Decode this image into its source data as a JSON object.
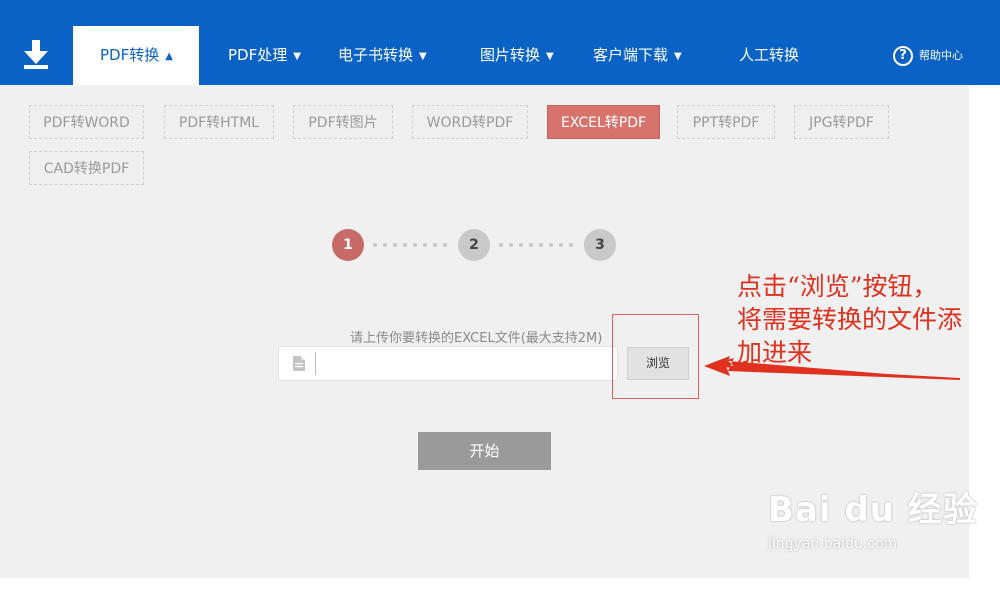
{
  "header": {
    "download_icon": "download-icon",
    "nav": [
      {
        "label": "PDF转换",
        "caret": "▲"
      },
      {
        "label": "PDF处理",
        "caret": "▼"
      },
      {
        "label": "电子书转换",
        "caret": "▼"
      },
      {
        "label": "图片转换",
        "caret": "▼"
      },
      {
        "label": "客户端下载",
        "caret": "▼"
      },
      {
        "label": "人工转换",
        "caret": ""
      }
    ],
    "help": {
      "icon_text": "?",
      "label": "帮助中心"
    }
  },
  "chips": [
    {
      "label": "PDF转WORD"
    },
    {
      "label": "PDF转HTML"
    },
    {
      "label": "PDF转图片"
    },
    {
      "label": "WORD转PDF"
    },
    {
      "label": "EXCEL转PDF",
      "active": true
    },
    {
      "label": "PPT转PDF"
    },
    {
      "label": "JPG转PDF"
    },
    {
      "label": "CAD转换PDF"
    }
  ],
  "steps": [
    {
      "label": "1",
      "active": true
    },
    {
      "label": "2"
    },
    {
      "label": "3"
    }
  ],
  "upload": {
    "hint": "请上传你要转换的EXCEL文件(最大支持2M)",
    "value": "",
    "browse_label": "浏览"
  },
  "start_label": "开始",
  "annotation": {
    "line1": "点击“浏览”按钮，",
    "line2": "将需要转换的文件添",
    "line3": "加进来"
  },
  "watermark": {
    "brand": "Bai du 经验",
    "url": "jingyan.baidu.com"
  },
  "colors": {
    "header": "#0a63c4",
    "active_chip": "#d7736d",
    "step_active": "#c66b68",
    "annotation": "#e0301e"
  }
}
